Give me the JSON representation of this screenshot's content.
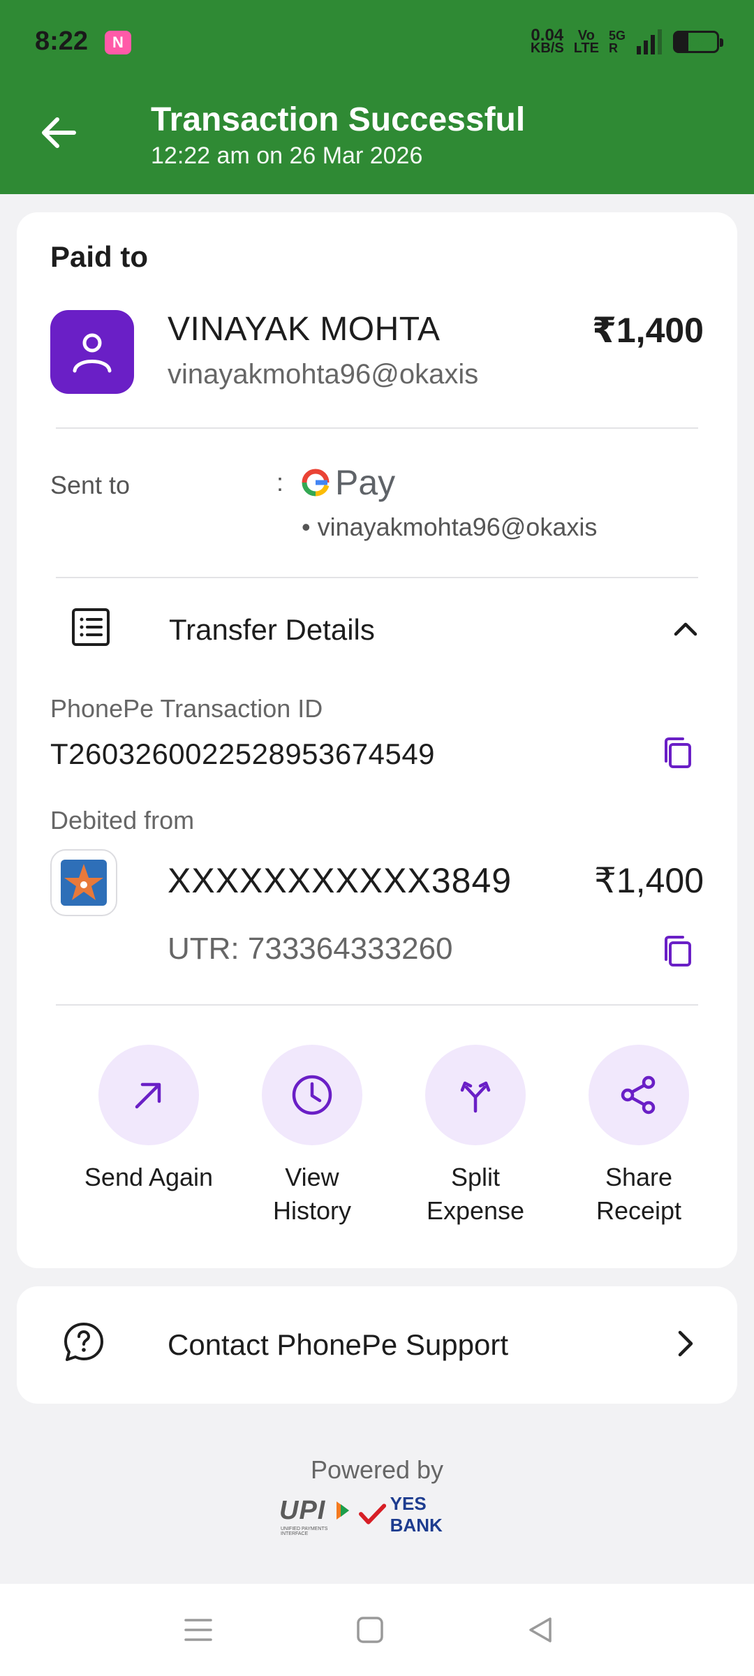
{
  "status_bar": {
    "time": "8:22",
    "notif_letter": "N",
    "net_speed_value": "0.04",
    "net_speed_unit": "KB/S",
    "volte_top": "Vo",
    "volte_bottom": "LTE",
    "signal_label": "5G",
    "signal_sub": "R",
    "battery": "30"
  },
  "header": {
    "title": "Transaction Successful",
    "subtitle": "12:22 am on 26 Mar 2026"
  },
  "paid_to": {
    "label": "Paid to",
    "name": "VINAYAK MOHTA",
    "upi": "vinayakmohta96@okaxis",
    "amount": "₹1,400"
  },
  "sent_to": {
    "label": "Sent to",
    "colon": ":",
    "app_name": "Pay",
    "upi": "• vinayakmohta96@okaxis"
  },
  "transfer_details": {
    "title": "Transfer Details",
    "txn_label": "PhonePe Transaction ID",
    "txn_id": "T2603260022528953674549",
    "debited_label": "Debited from",
    "account": "XXXXXXXXXXX3849",
    "amount": "₹1,400",
    "utr": "UTR: 733364333260"
  },
  "actions": [
    {
      "label_1": "Send Again",
      "label_2": "",
      "icon": "arrow-up-right-icon"
    },
    {
      "label_1": "View",
      "label_2": "History",
      "icon": "clock-icon"
    },
    {
      "label_1": "Split",
      "label_2": "Expense",
      "icon": "split-icon"
    },
    {
      "label_1": "Share",
      "label_2": "Receipt",
      "icon": "share-icon"
    }
  ],
  "support": {
    "label": "Contact PhonePe Support"
  },
  "footer": {
    "powered_by": "Powered by",
    "upi_logo": "UPI",
    "upi_sub": "UNIFIED PAYMENTS INTERFACE",
    "bank_logo": "YES BANK"
  },
  "colors": {
    "header_green": "#2f8a34",
    "accent_purple": "#6a1fc6",
    "action_bg": "#f1e8fc"
  }
}
